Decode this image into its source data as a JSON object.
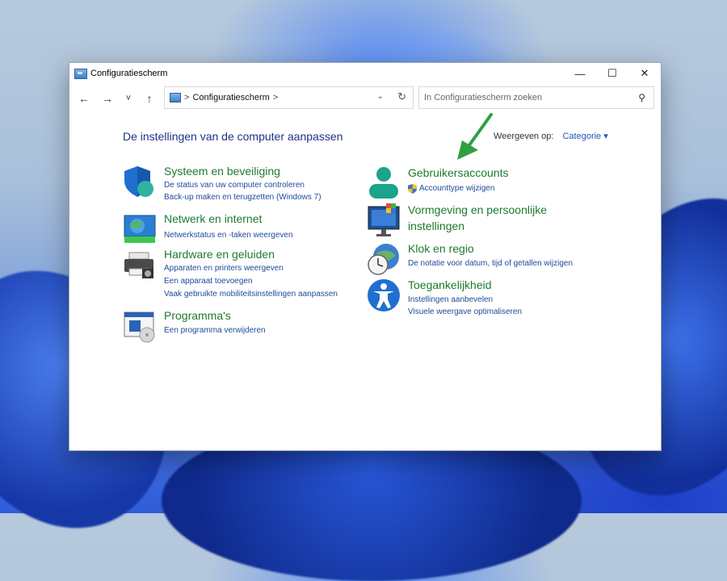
{
  "window": {
    "title": "Configuratiescherm"
  },
  "controls": {
    "minimize": "—",
    "maximize": "☐",
    "close": "✕"
  },
  "nav": {
    "back": "←",
    "forward": "→",
    "recent": "˅",
    "up": "↑"
  },
  "address": {
    "separator": ">",
    "crumb": "Configuratiescherm",
    "trailing_sep": ">",
    "dropdown": "⌄",
    "refresh": "↻"
  },
  "search": {
    "placeholder": "In Configuratiescherm zoeken",
    "icon": "⚲"
  },
  "main": {
    "heading": "De instellingen van de computer aanpassen",
    "view_label": "Weergeven op:",
    "view_value": "Categorie ▾"
  },
  "categories_left": [
    {
      "icon": "shield-icon",
      "title": "Systeem en beveiliging",
      "links": [
        "De status van uw computer controleren",
        "Back-up maken en terugzetten (Windows 7)"
      ]
    },
    {
      "icon": "network-icon",
      "title": "Netwerk en internet",
      "links": [
        "Netwerkstatus en -taken weergeven"
      ]
    },
    {
      "icon": "printer-icon",
      "title": "Hardware en geluiden",
      "links": [
        "Apparaten en printers weergeven",
        "Een apparaat toevoegen",
        "Vaak gebruikte mobiliteitsinstellingen aanpassen"
      ]
    },
    {
      "icon": "programs-icon",
      "title": "Programma's",
      "links": [
        "Een programma verwijderen"
      ]
    }
  ],
  "categories_right": [
    {
      "icon": "user-accounts-icon",
      "title": "Gebruikersaccounts",
      "links": [
        "Accounttype wijzigen"
      ]
    },
    {
      "icon": "appearance-icon",
      "title": "Vormgeving en persoonlijke instellingen",
      "title_line2": "instellingen",
      "title_line1": "Vormgeving en persoonlijke",
      "links": []
    },
    {
      "icon": "clock-icon",
      "title": "Klok en regio",
      "links": [
        "De notatie voor datum, tijd of getallen wijzigen"
      ]
    },
    {
      "icon": "accessibility-icon",
      "title": "Toegankelijkheid",
      "links": [
        "Instellingen aanbevelen",
        "Visuele weergave optimaliseren"
      ]
    }
  ],
  "colors": {
    "heading": "#1e3287",
    "category_title": "#1e7a2e",
    "link": "#1e4a9a",
    "annotation_arrow": "#2ea043"
  }
}
